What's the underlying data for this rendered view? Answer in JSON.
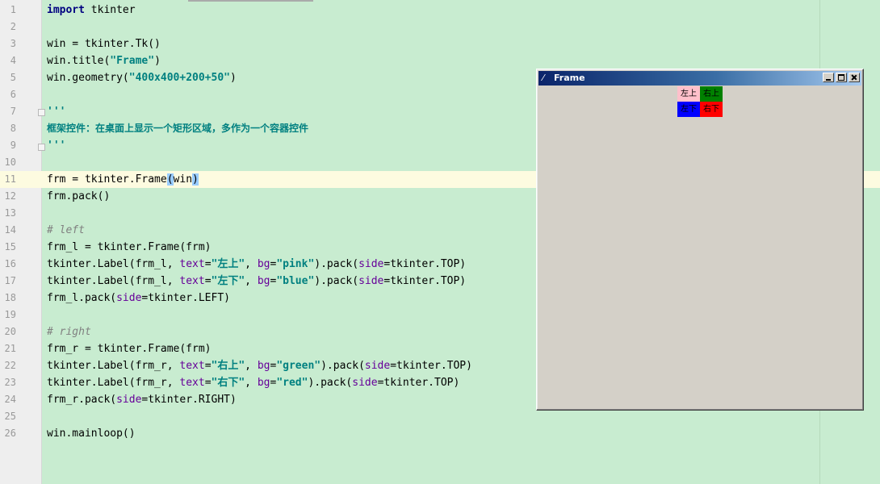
{
  "editor": {
    "lines": [
      {
        "n": "1"
      },
      {
        "n": "2"
      },
      {
        "n": "3"
      },
      {
        "n": "4"
      },
      {
        "n": "5"
      },
      {
        "n": "6"
      },
      {
        "n": "7"
      },
      {
        "n": "8"
      },
      {
        "n": "9"
      },
      {
        "n": "10"
      },
      {
        "n": "11"
      },
      {
        "n": "12"
      },
      {
        "n": "13"
      },
      {
        "n": "14"
      },
      {
        "n": "15"
      },
      {
        "n": "16"
      },
      {
        "n": "17"
      },
      {
        "n": "18"
      },
      {
        "n": "19"
      },
      {
        "n": "20"
      },
      {
        "n": "21"
      },
      {
        "n": "22"
      },
      {
        "n": "23"
      },
      {
        "n": "24"
      },
      {
        "n": "25"
      },
      {
        "n": "26"
      }
    ],
    "code": {
      "l1_kw": "import",
      "l1_rest": " tkinter",
      "l3": "win = tkinter.Tk()",
      "l4_a": "win.title(",
      "l4_s": "\"Frame\"",
      "l4_b": ")",
      "l5_a": "win.geometry(",
      "l5_s": "\"400x400+200+50\"",
      "l5_b": ")",
      "l7": "'''",
      "l8": "框架控件：在桌面上显示一个矩形区域，多作为一个容器控件",
      "l9": "'''",
      "l11_a": "frm = tkinter.Frame",
      "l11_p1": "(",
      "l11_b": "win",
      "l11_p2": ")",
      "l12": "frm.pack()",
      "l14": "# left",
      "l15": "frm_l = tkinter.Frame(frm)",
      "l16_a": "tkinter.Label(frm_l, ",
      "l16_k1": "text",
      "l16_eq1": "=",
      "l16_s1": "\"左上\"",
      "l16_c": ", ",
      "l16_k2": "bg",
      "l16_eq2": "=",
      "l16_s2": "\"pink\"",
      "l16_d": ").pack(",
      "l16_k3": "side",
      "l16_e": "=tkinter.TOP)",
      "l17_a": "tkinter.Label(frm_l, ",
      "l17_k1": "text",
      "l17_eq1": "=",
      "l17_s1": "\"左下\"",
      "l17_c": ", ",
      "l17_k2": "bg",
      "l17_eq2": "=",
      "l17_s2": "\"blue\"",
      "l17_d": ").pack(",
      "l17_k3": "side",
      "l17_e": "=tkinter.TOP)",
      "l18_a": "frm_l.pack(",
      "l18_k": "side",
      "l18_e": "=tkinter.LEFT)",
      "l20": "# right",
      "l21": "frm_r = tkinter.Frame(frm)",
      "l22_a": "tkinter.Label(frm_r, ",
      "l22_k1": "text",
      "l22_eq1": "=",
      "l22_s1": "\"右上\"",
      "l22_c": ", ",
      "l22_k2": "bg",
      "l22_eq2": "=",
      "l22_s2": "\"green\"",
      "l22_d": ").pack(",
      "l22_k3": "side",
      "l22_e": "=tkinter.TOP)",
      "l23_a": "tkinter.Label(frm_r, ",
      "l23_k1": "text",
      "l23_eq1": "=",
      "l23_s1": "\"右下\"",
      "l23_c": ", ",
      "l23_k2": "bg",
      "l23_eq2": "=",
      "l23_s2": "\"red\"",
      "l23_d": ").pack(",
      "l23_k3": "side",
      "l23_e": "=tkinter.TOP)",
      "l24_a": "frm_r.pack(",
      "l24_k": "side",
      "l24_e": "=tkinter.RIGHT)",
      "l26": "win.mainloop()"
    }
  },
  "tk_window": {
    "title": "Frame",
    "icon": "feather-icon",
    "labels": {
      "top_left": "左上",
      "bottom_left": "左下",
      "top_right": "右上",
      "bottom_right": "右下"
    },
    "colors": {
      "pink": "#ffc0cb",
      "blue": "#0000ff",
      "green": "#008000",
      "red": "#ff0000"
    }
  },
  "colors": {
    "editor_bg": "#c8ecd0",
    "current_line": "#fdfbe0",
    "keyword": "#000080",
    "string": "#008080",
    "kwarg": "#660099",
    "comment": "#808080"
  }
}
